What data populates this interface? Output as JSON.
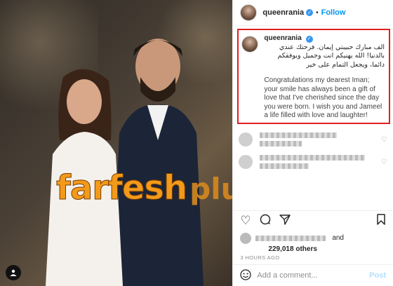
{
  "header": {
    "username": "queenrania",
    "follow_label": "Follow",
    "dot": "•"
  },
  "caption": {
    "username": "queenrania",
    "arabic_text": "الف مبارك حبيبتي إيمان. فرحتك عندي بالدنيا! الله يهنيكم انت وجميل ويوفقكم دائما، ويجعل التمام على خير",
    "english_text": "Congratulations my dearest Iman; your smile has always been a gift of love that I've cherished since the day you were born. I wish you and Jameel a life filled with love and laughter!"
  },
  "watermark": {
    "main": "farfesh",
    "plus": "plus.com"
  },
  "likes": {
    "and1": "and",
    "count": "229,018 others"
  },
  "timestamp": "3 HOURS AGO",
  "comment_box": {
    "placeholder": "Add a comment...",
    "post_label": "Post"
  },
  "colors": {
    "accent": "#0095f6",
    "highlight_border": "#e02020",
    "watermark": "#f39a1a"
  }
}
